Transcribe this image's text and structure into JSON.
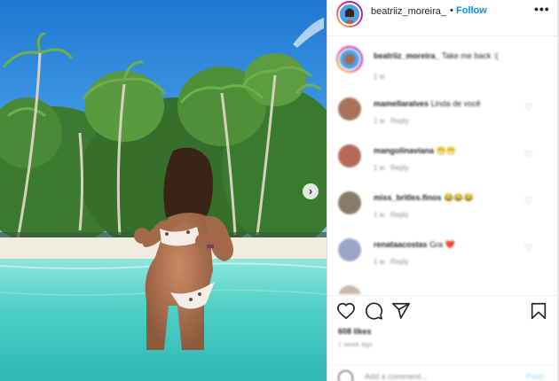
{
  "post": {
    "username": "beatriiz_moreira_",
    "follow_label": "Follow",
    "separator": "•",
    "more_label": "•••",
    "next_label": "›"
  },
  "caption": {
    "username": "beatriiz_moreira_",
    "text": "Take me back :(",
    "time": "1 w"
  },
  "comments": [
    {
      "username": "mamellaralves",
      "text": "Linda de você",
      "time": "1 w",
      "reply": "Reply"
    },
    {
      "username": "mangolinaviana",
      "text": "😁😁",
      "time": "1 w",
      "reply": "Reply"
    },
    {
      "username": "miss_britles.finos",
      "text": "😂😂😂",
      "time": "1 w",
      "reply": "Reply"
    },
    {
      "username": "renataacostas",
      "text": "Gra ❤️",
      "time": "1 w",
      "reply": "Reply"
    },
    {
      "username": "",
      "text": "",
      "time": "",
      "reply": ""
    }
  ],
  "footer": {
    "likes": "608 likes",
    "time": "1 week ago",
    "add_comment_placeholder": "Add a comment...",
    "post_label": "Post"
  },
  "colors": {
    "follow": "#0095f6",
    "sky": "#2f8ad8",
    "water": "#5fd6cf",
    "sand": "#f1ece0"
  },
  "icons": {
    "like": "heart-icon",
    "comment": "comment-icon",
    "share": "share-icon",
    "save": "bookmark-icon",
    "emoji": "emoji-icon"
  }
}
